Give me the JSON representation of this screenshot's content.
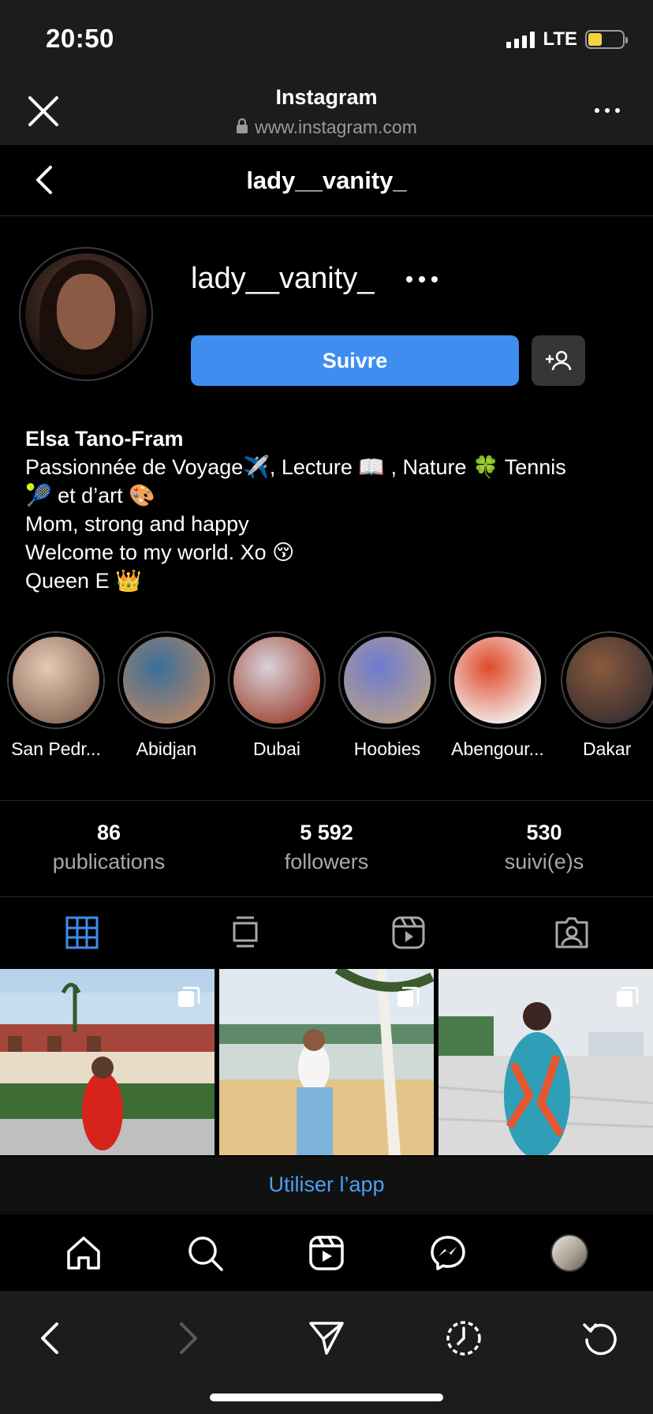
{
  "status_bar": {
    "time": "20:50",
    "network": "LTE",
    "battery_level": 0.4,
    "battery_color": "#f6d244"
  },
  "browser": {
    "title": "Instagram",
    "url": "www.instagram.com"
  },
  "profile_nav": {
    "title": "lady__vanity_"
  },
  "profile": {
    "username": "lady__vanity_",
    "follow_label": "Suivre",
    "follow_color": "#3e8ef0",
    "bio": {
      "name": "Elsa Tano-Fram",
      "lines": [
        "Passionnée de Voyage✈️, Lecture 📖 , Nature 🍀 Tennis",
        "🎾 et d’art 🎨",
        "Mom, strong and happy",
        "Welcome to my world. Xo 😚",
        "Queen E 👑"
      ]
    }
  },
  "highlights": [
    {
      "label": "San Pedr...",
      "colors": [
        "#e6c9b4",
        "#8a6a58"
      ]
    },
    {
      "label": "Abidjan",
      "colors": [
        "#3a6f9c",
        "#b08466"
      ]
    },
    {
      "label": "Dubai",
      "colors": [
        "#d8d1d8",
        "#a14a3a"
      ]
    },
    {
      "label": "Hoobies",
      "colors": [
        "#6d7bd0",
        "#b7a08a"
      ]
    },
    {
      "label": "Abengour...",
      "colors": [
        "#e04a2a",
        "#f2f2f2"
      ]
    },
    {
      "label": "Dakar",
      "colors": [
        "#8a5a3e",
        "#3a3030"
      ]
    }
  ],
  "stats": [
    {
      "value": "86",
      "label": "publications"
    },
    {
      "value": "5 592",
      "label": "followers"
    },
    {
      "value": "530",
      "label": "suivi(e)s"
    }
  ],
  "tabs": [
    {
      "name": "grid-icon",
      "active": true
    },
    {
      "name": "feed-icon",
      "active": false
    },
    {
      "name": "reels-icon",
      "active": false
    },
    {
      "name": "tagged-icon",
      "active": false
    }
  ],
  "posts": [
    {
      "description_colors": [
        "#9ec1e0",
        "#c25c3a",
        "#2e6b2e"
      ],
      "multi": true
    },
    {
      "description_colors": [
        "#cfe3ee",
        "#e8c98a",
        "#6fa3c9"
      ],
      "multi": true
    },
    {
      "description_colors": [
        "#e4e6ea",
        "#d8d8d8",
        "#2f9fb8"
      ],
      "multi": true
    }
  ],
  "use_app_label": "Utiliser l’app",
  "accent_color": "#3e8ef0"
}
